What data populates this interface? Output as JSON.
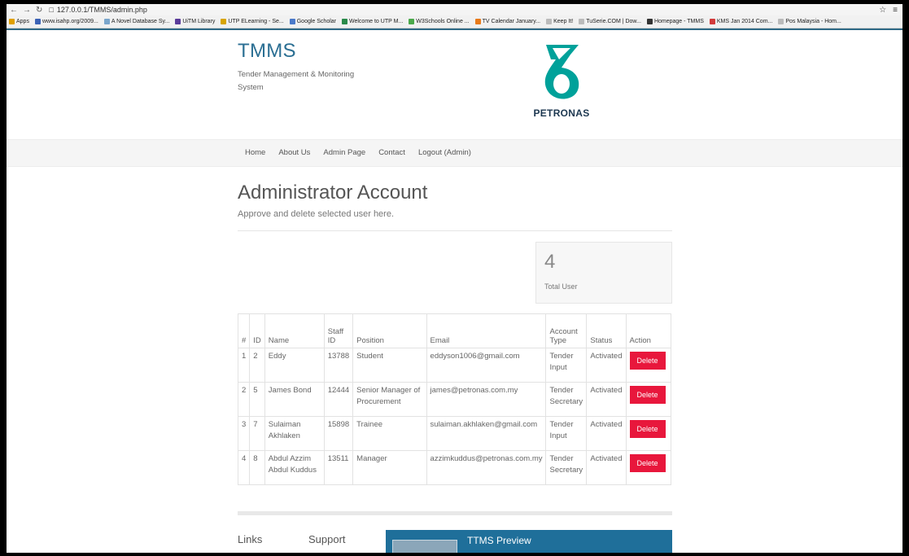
{
  "browser": {
    "url": "127.0.0.1/TMMS/admin.php",
    "bookmarks": [
      {
        "label": "Apps",
        "color": "#e0a000"
      },
      {
        "label": "www.isahp.org/2009...",
        "color": "#3b62b5"
      },
      {
        "label": "A Novel Database Sy...",
        "color": "#7aa6cc"
      },
      {
        "label": "UiTM Library",
        "color": "#5a3b9a"
      },
      {
        "label": "UTP ELearning - Se...",
        "color": "#d8a400"
      },
      {
        "label": "Google Scholar",
        "color": "#4a79c9"
      },
      {
        "label": "Welcome to UTP M...",
        "color": "#2a8a4a"
      },
      {
        "label": "W3Schools Online ...",
        "color": "#4aa84a"
      },
      {
        "label": "TV Calendar January...",
        "color": "#e87a1a"
      },
      {
        "label": "Keep It!",
        "color": "#bbbbbb"
      },
      {
        "label": "TuSerie.COM | Dow...",
        "color": "#bbbbbb"
      },
      {
        "label": "Homepage - TMMS",
        "color": "#333333"
      },
      {
        "label": "KMS Jan 2014 Com...",
        "color": "#d23a3a"
      },
      {
        "label": "Pos Malaysia - Hom...",
        "color": "#bbbbbb"
      }
    ]
  },
  "header": {
    "title": "TMMS",
    "subtitle": "Tender Management & Monitoring System",
    "logo_text": "PETRONAS"
  },
  "nav": {
    "items": [
      "Home",
      "About Us",
      "Admin Page",
      "Contact",
      "Logout (Admin)"
    ]
  },
  "main": {
    "title": "Administrator Account",
    "subtitle": "Approve and delete selected user here.",
    "stat_value": "4",
    "stat_label": "Total User"
  },
  "table": {
    "headers": [
      "#",
      "ID",
      "Name",
      "Staff ID",
      "Position",
      "Email",
      "Account Type",
      "Status",
      "Action"
    ],
    "rows": [
      {
        "num": "1",
        "id": "2",
        "name": "Eddy",
        "staff_id": "13788",
        "position": "Student",
        "email": "eddyson1006@gmail.com",
        "account_type": "Tender Input",
        "status": "Activated",
        "action": "Delete"
      },
      {
        "num": "2",
        "id": "5",
        "name": "James Bond",
        "staff_id": "12444",
        "position": "Senior Manager of Procurement",
        "email": "james@petronas.com.my",
        "account_type": "Tender Secretary",
        "status": "Activated",
        "action": "Delete"
      },
      {
        "num": "3",
        "id": "7",
        "name": "Sulaiman Akhlaken",
        "staff_id": "15898",
        "position": "Trainee",
        "email": "sulaiman.akhlaken@gmail.com",
        "account_type": "Tender Input",
        "status": "Activated",
        "action": "Delete"
      },
      {
        "num": "4",
        "id": "8",
        "name": "Abdul Azzim Abdul Kuddus",
        "staff_id": "13511",
        "position": "Manager",
        "email": "azzimkuddus@petronas.com.my",
        "account_type": "Tender Secretary",
        "status": "Activated",
        "action": "Delete"
      }
    ]
  },
  "footer": {
    "links_title": "Links",
    "support_title": "Support",
    "preview_title": "TTMS Preview"
  },
  "colors": {
    "accent": "#2b6f93",
    "delete": "#e8173c",
    "logo_green": "#00a19a"
  }
}
